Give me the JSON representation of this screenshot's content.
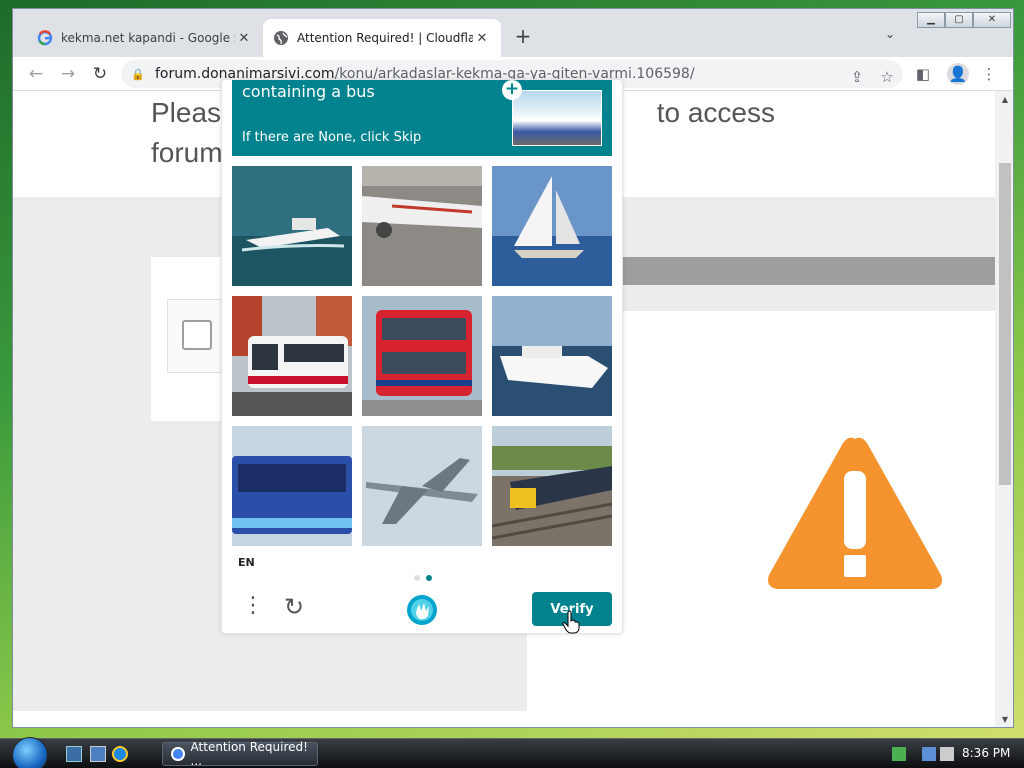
{
  "browser": {
    "tabs": [
      {
        "title": "kekma.net kapandi - Google Sear",
        "active": false
      },
      {
        "title": "Attention Required! | Cloudflare",
        "active": true
      }
    ],
    "new_tab": "+",
    "address": {
      "host": "forum.donanimarsivi.com",
      "path": "/konu/arkadaslar-kekma-ga-ya-giten-varmi.106598/"
    }
  },
  "page": {
    "heading_line1": "Please                                                      to access",
    "heading_line2": "forum"
  },
  "captcha": {
    "prompt_line1": "containing a bus",
    "prompt_line2": "If there are None, click Skip",
    "language": "EN",
    "verify_label": "Verify",
    "tiles": [
      {
        "subject": "motor-yacht"
      },
      {
        "subject": "airplane-on-runway"
      },
      {
        "subject": "sailboat"
      },
      {
        "subject": "city-bus-white-red"
      },
      {
        "subject": "double-decker-bus"
      },
      {
        "subject": "white-yacht"
      },
      {
        "subject": "blue-bus"
      },
      {
        "subject": "airplane-landing"
      },
      {
        "subject": "train"
      }
    ]
  },
  "taskbar": {
    "window_button": "Attention Required! ...",
    "clock": "8:36 PM"
  },
  "colors": {
    "captcha_teal": "#00838f",
    "warning_orange": "#f5932f"
  }
}
